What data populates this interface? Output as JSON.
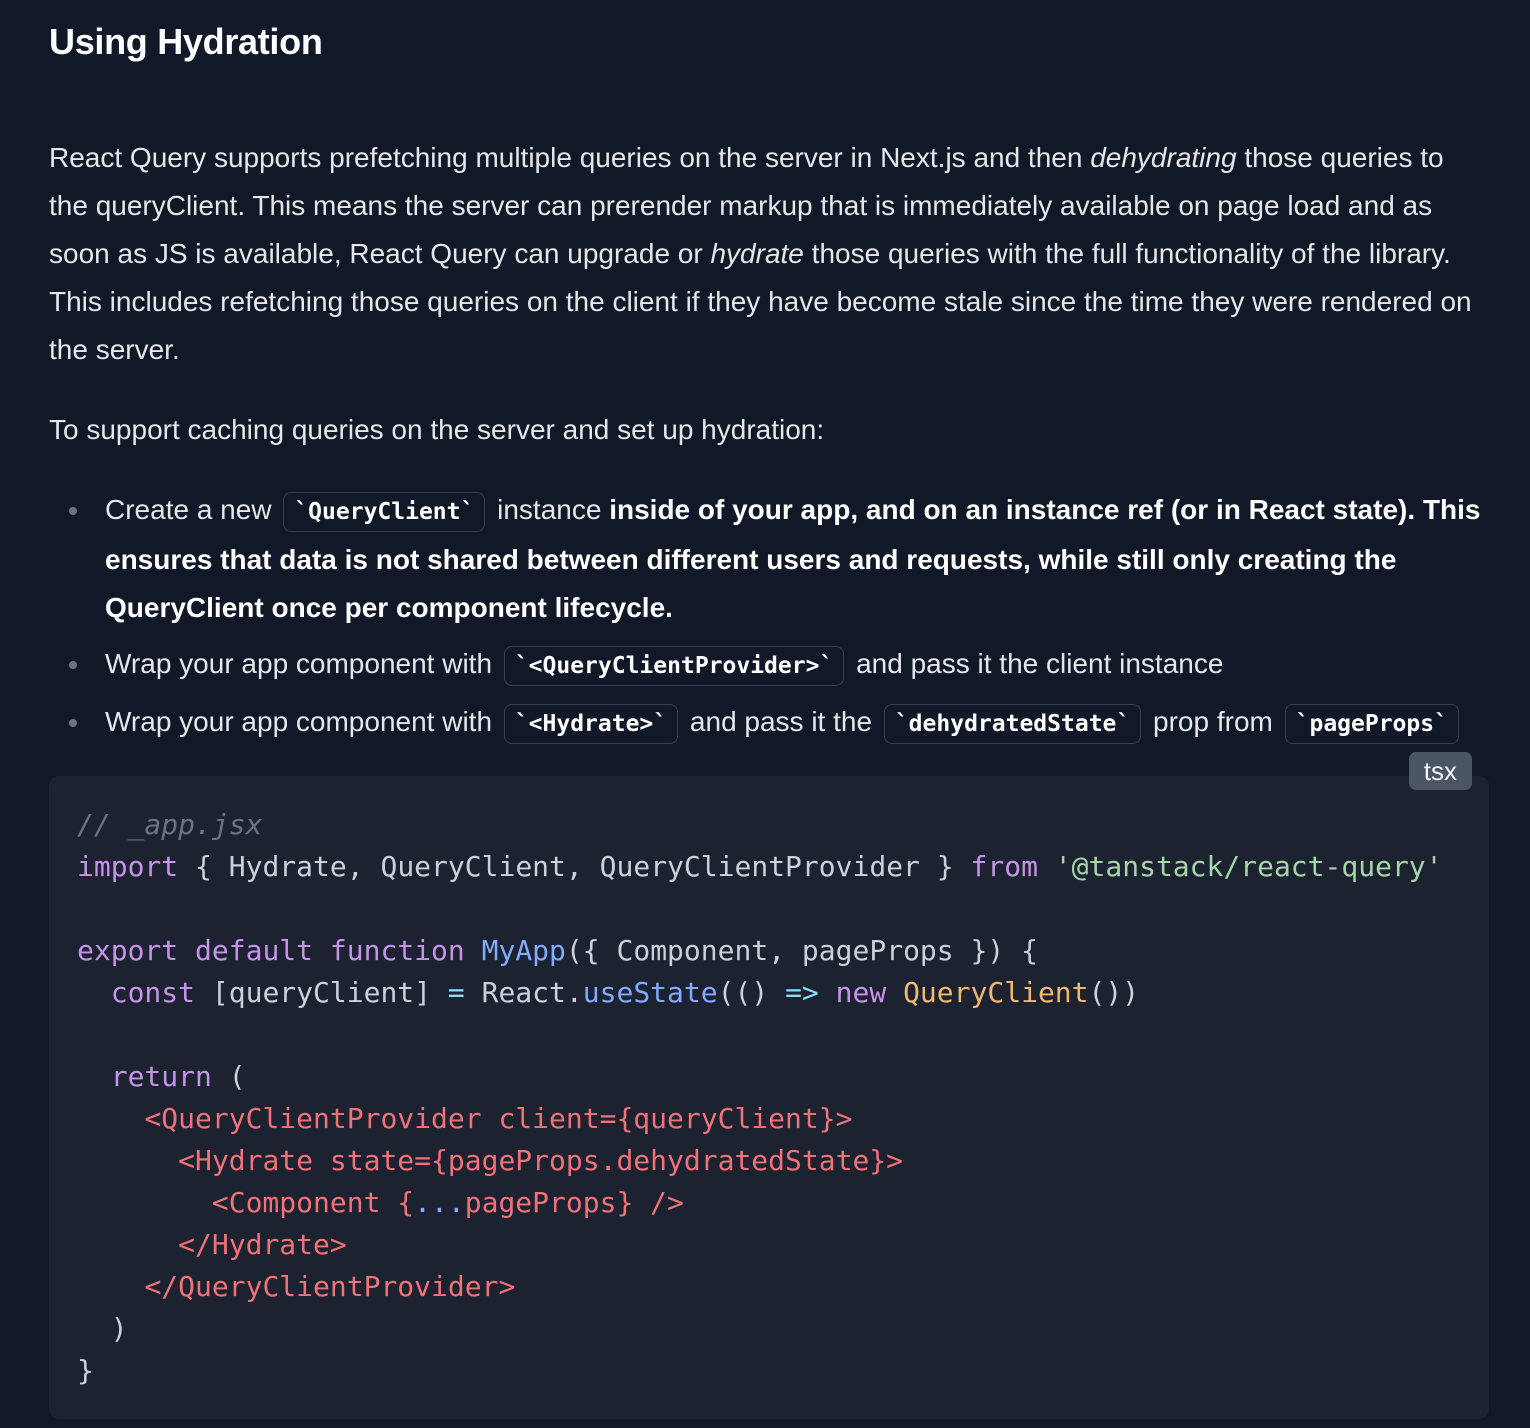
{
  "heading": "Using Hydration",
  "intro": {
    "p1_a": "React Query supports prefetching multiple queries on the server in Next.js and then ",
    "p1_em1": "dehydrating",
    "p1_b": " those queries to the queryClient. This means the server can prerender markup that is immediately available on page load and as soon as JS is available, React Query can upgrade or ",
    "p1_em2": "hydrate",
    "p1_c": " those queries with the full functionality of the library. This includes refetching those queries on the client if they have become stale since the time they were rendered on the server.",
    "p2": "To support caching queries on the server and set up hydration:"
  },
  "steps": [
    {
      "pre": "Create a new ",
      "code": "`QueryClient`",
      "mid": " instance ",
      "bold": "inside of your app, and on an instance ref (or in React state). This ensures that data is not shared between different users and requests, while still only creating the QueryClient once per component lifecycle."
    },
    {
      "pre": "Wrap your app component with ",
      "code": "`<QueryClientProvider>`",
      "post": " and pass it the client instance"
    },
    {
      "pre": "Wrap your app component with ",
      "code1": "`<Hydrate>`",
      "mid": " and pass it the ",
      "code2": "`dehydratedState`",
      "mid2": " prop from ",
      "code3": "`pageProps`"
    }
  ],
  "code_block": {
    "language": "tsx",
    "lines": [
      "// _app.jsx",
      "import { Hydrate, QueryClient, QueryClientProvider } from '@tanstack/react-query'",
      "",
      "export default function MyApp({ Component, pageProps }) {",
      "  const [queryClient] = React.useState(() => new QueryClient())",
      "",
      "  return (",
      "    <QueryClientProvider client={queryClient}>",
      "      <Hydrate state={pageProps.dehydratedState}>",
      "        <Component {...pageProps} />",
      "      </Hydrate>",
      "    </QueryClientProvider>",
      "  )",
      "}"
    ]
  },
  "colors": {
    "background": "#111827",
    "code_background": "#1c2230",
    "keyword": "#c792ea",
    "string": "#a5d6a7",
    "function": "#82aaff",
    "class": "#f0b86e",
    "jsx_tag": "#f07178",
    "comment": "#6b7280"
  }
}
